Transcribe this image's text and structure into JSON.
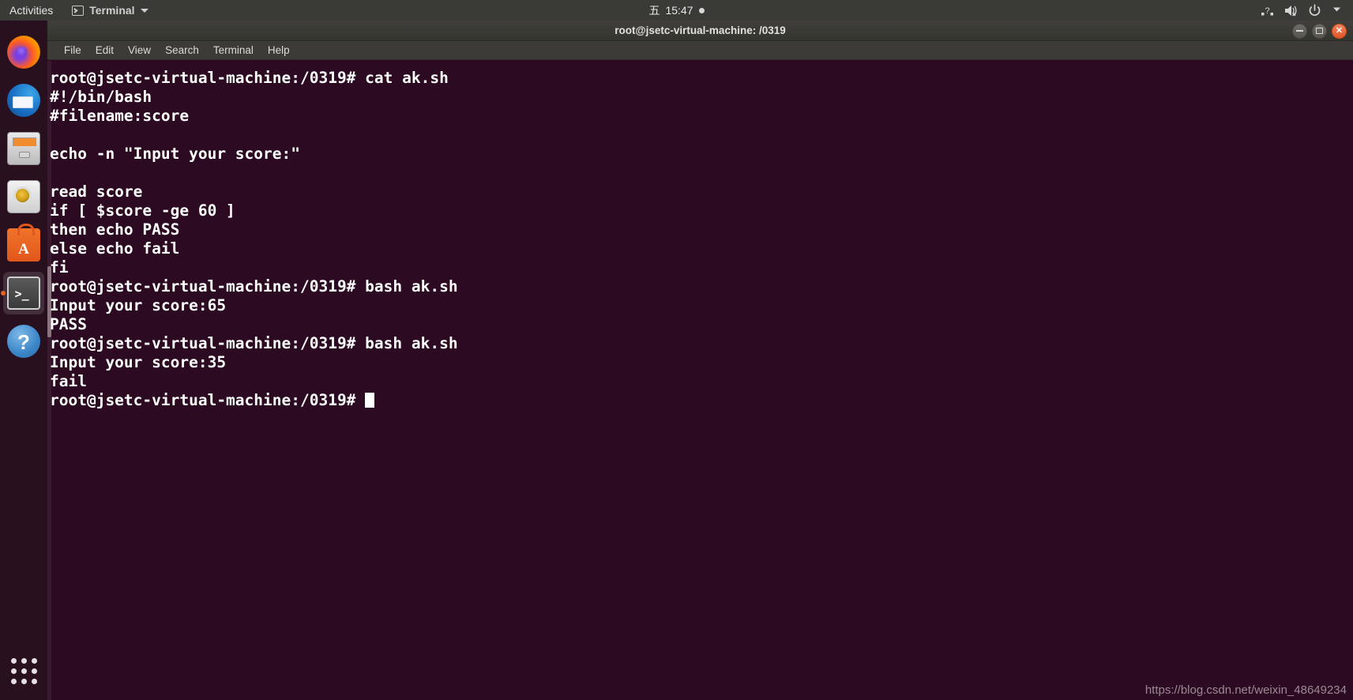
{
  "topbar": {
    "activities": "Activities",
    "app_menu_label": "Terminal",
    "app_menu_icon": "terminal-icon",
    "clock_day": "五",
    "clock_time": "15:47",
    "tray_icons": [
      "network-question-icon",
      "volume-muted-icon",
      "power-icon",
      "chevron-down-icon"
    ]
  },
  "dock": {
    "items": [
      {
        "name": "firefox",
        "label": "Firefox",
        "active": false
      },
      {
        "name": "thunderbird",
        "label": "Thunderbird",
        "active": false
      },
      {
        "name": "files",
        "label": "Files",
        "active": false
      },
      {
        "name": "rhythmbox",
        "label": "Rhythmbox",
        "active": false
      },
      {
        "name": "ubuntu-software",
        "label": "Ubuntu Software",
        "active": false
      },
      {
        "name": "terminal",
        "label": "Terminal",
        "active": true
      },
      {
        "name": "help",
        "label": "Help",
        "active": false
      }
    ],
    "show_applications": "Show Applications"
  },
  "window": {
    "title": "root@jsetc-virtual-machine: /0319",
    "controls": {
      "minimize": "minimize-button",
      "maximize": "maximize-button",
      "close": "close-button"
    },
    "menus": [
      "File",
      "Edit",
      "View",
      "Search",
      "Terminal",
      "Help"
    ]
  },
  "terminal": {
    "prompt": "root@jsetc-virtual-machine:/0319#",
    "lines": [
      "root@jsetc-virtual-machine:/0319# cat ak.sh",
      "#!/bin/bash",
      "#filename:score",
      "",
      "echo -n \"Input your score:\"",
      "",
      "read score",
      "if [ $score -ge 60 ]",
      "then echo PASS",
      "else echo fail",
      "fi",
      "root@jsetc-virtual-machine:/0319# bash ak.sh",
      "Input your score:65",
      "PASS",
      "root@jsetc-virtual-machine:/0319# bash ak.sh",
      "Input your score:35",
      "fail"
    ],
    "last_line": "root@jsetc-virtual-machine:/0319# ",
    "background_color": "#2c0a21",
    "text_color": "#ffffff"
  },
  "watermark": "https://blog.csdn.net/weixin_48649234"
}
